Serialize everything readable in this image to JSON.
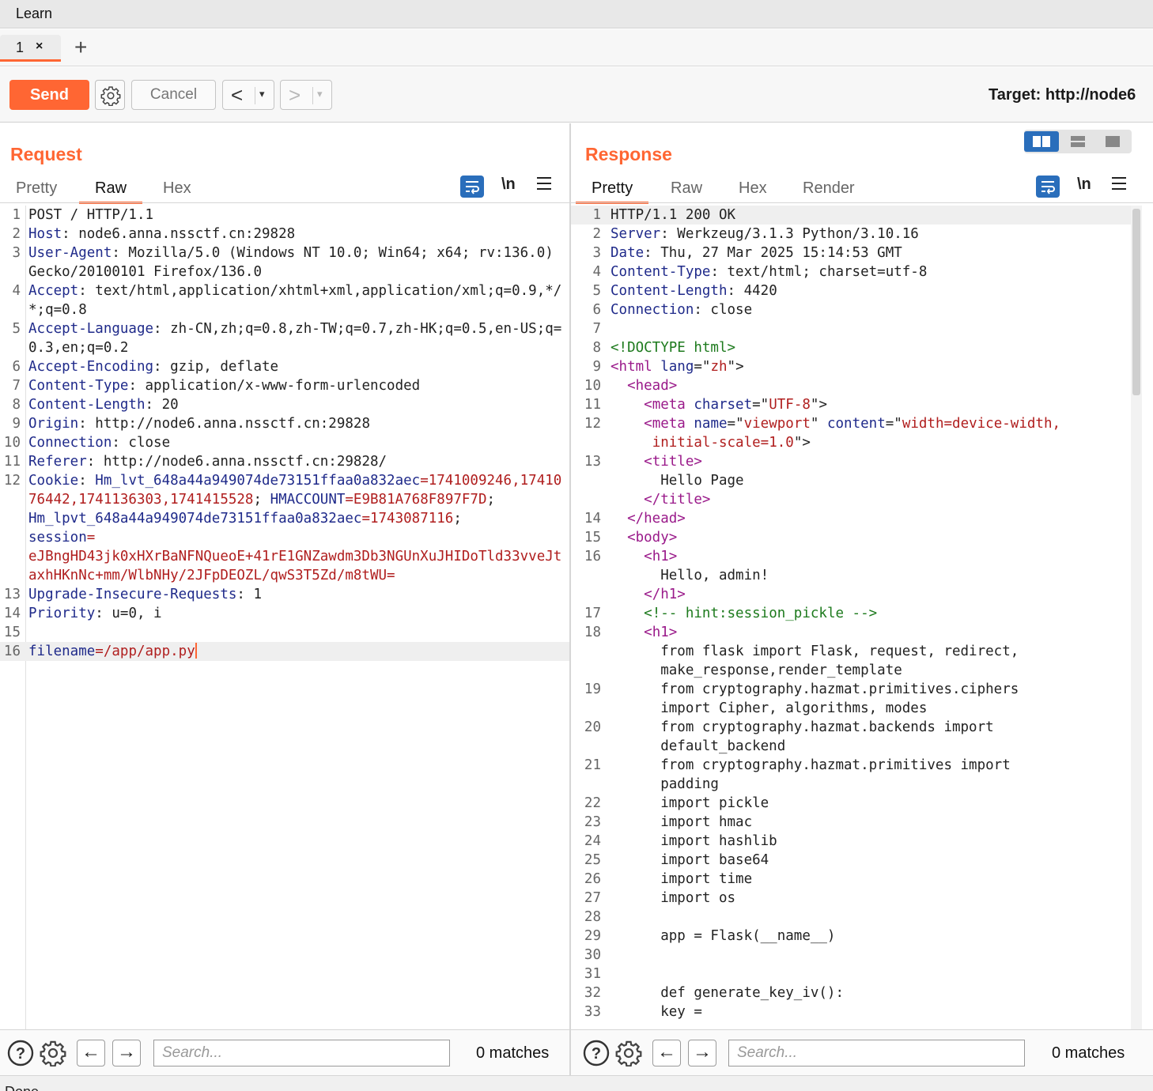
{
  "menu": {
    "learn": "Learn"
  },
  "tabs": {
    "tab1": "1",
    "close": "×",
    "add": "+"
  },
  "toolbar": {
    "send": "Send",
    "cancel": "Cancel",
    "back": "<",
    "forward": ">",
    "caret": "▾",
    "target": "Target: http://node6"
  },
  "request": {
    "title": "Request",
    "tabs": [
      "Pretty",
      "Raw",
      "Hex"
    ],
    "active_tab": "Raw",
    "newline_toggle": "\\n",
    "search_placeholder": "Search...",
    "matches": "0 matches",
    "lines": [
      {
        "n": "1",
        "segs": [
          {
            "t": "POST / HTTP/1.1",
            "c": "hval"
          }
        ]
      },
      {
        "n": "2",
        "segs": [
          {
            "t": "Host",
            "c": "hname"
          },
          {
            "t": ": node6.anna.nssctf.cn:29828",
            "c": "hval"
          }
        ]
      },
      {
        "n": "3",
        "segs": [
          {
            "t": "User-Agent",
            "c": "hname"
          },
          {
            "t": ": Mozilla/5.0 (Windows NT 10.0; Win64; x64; rv:136.0) Gecko/20100101 Firefox/136.0",
            "c": "hval"
          }
        ]
      },
      {
        "n": "4",
        "segs": [
          {
            "t": "Accept",
            "c": "hname"
          },
          {
            "t": ": text/html,application/xhtml+xml,application/xml;q=0.9,*/*;q=0.8",
            "c": "hval"
          }
        ]
      },
      {
        "n": "5",
        "segs": [
          {
            "t": "Accept-Language",
            "c": "hname"
          },
          {
            "t": ": zh-CN,zh;q=0.8,zh-TW;q=0.7,zh-HK;q=0.5,en-US;q=0.3,en;q=0.2",
            "c": "hval"
          }
        ]
      },
      {
        "n": "6",
        "segs": [
          {
            "t": "Accept-Encoding",
            "c": "hname"
          },
          {
            "t": ": gzip, deflate",
            "c": "hval"
          }
        ]
      },
      {
        "n": "7",
        "segs": [
          {
            "t": "Content-Type",
            "c": "hname"
          },
          {
            "t": ": application/x-www-form-urlencoded",
            "c": "hval"
          }
        ]
      },
      {
        "n": "8",
        "segs": [
          {
            "t": "Content-Length",
            "c": "hname"
          },
          {
            "t": ": 20",
            "c": "hval"
          }
        ]
      },
      {
        "n": "9",
        "segs": [
          {
            "t": "Origin",
            "c": "hname"
          },
          {
            "t": ": http://node6.anna.nssctf.cn:29828",
            "c": "hval"
          }
        ]
      },
      {
        "n": "10",
        "segs": [
          {
            "t": "Connection",
            "c": "hname"
          },
          {
            "t": ": close",
            "c": "hval"
          }
        ]
      },
      {
        "n": "11",
        "segs": [
          {
            "t": "Referer",
            "c": "hname"
          },
          {
            "t": ": http://node6.anna.nssctf.cn:29828/",
            "c": "hval"
          }
        ]
      },
      {
        "n": "12",
        "segs": [
          {
            "t": "Cookie",
            "c": "hname"
          },
          {
            "t": ": ",
            "c": "hval"
          },
          {
            "t": "Hm_lvt_648a44a949074de73151ffaa0a832aec",
            "c": "hname"
          },
          {
            "t": "=1741009246,1741076442,1741136303,1741415528",
            "c": "cval"
          },
          {
            "t": "; ",
            "c": "hval"
          },
          {
            "t": "HMACCOUNT",
            "c": "hname"
          },
          {
            "t": "=E9B81A768F897F7D",
            "c": "cval"
          },
          {
            "t": ";\n",
            "c": "hval"
          },
          {
            "t": "Hm_lpvt_648a44a949074de73151ffaa0a832aec",
            "c": "hname"
          },
          {
            "t": "=1743087116",
            "c": "cval"
          },
          {
            "t": ";\n",
            "c": "hval"
          },
          {
            "t": "session",
            "c": "hname"
          },
          {
            "t": "=\neJBngHD43jk0xHXrBaNFNQueoE+41rE1GNZawdm3Db3NGUnXuJHIDoTld33vveJtaxhHKnNc+mm/WlbNHy/2JFpDEOZL/qwS3T5Zd/m8tWU=",
            "c": "cval"
          }
        ]
      },
      {
        "n": "13",
        "segs": [
          {
            "t": "Upgrade-Insecure-Requests",
            "c": "hname"
          },
          {
            "t": ": 1",
            "c": "hval"
          }
        ]
      },
      {
        "n": "14",
        "segs": [
          {
            "t": "Priority",
            "c": "hname"
          },
          {
            "t": ": u=0, i",
            "c": "hval"
          }
        ]
      },
      {
        "n": "15",
        "segs": [
          {
            "t": "",
            "c": "hval"
          }
        ]
      },
      {
        "n": "16",
        "segs": [
          {
            "t": "filename",
            "c": "hname"
          },
          {
            "t": "=/app/app.py",
            "c": "cval"
          }
        ],
        "current": true
      }
    ]
  },
  "response": {
    "title": "Response",
    "tabs": [
      "Pretty",
      "Raw",
      "Hex",
      "Render"
    ],
    "active_tab": "Pretty",
    "newline_toggle": "\\n",
    "search_placeholder": "Search...",
    "matches": "0 matches",
    "lines": [
      {
        "n": "1",
        "segs": [
          {
            "t": "HTTP/1.1 200 OK",
            "c": "hval"
          }
        ],
        "current": true
      },
      {
        "n": "2",
        "segs": [
          {
            "t": "Server",
            "c": "hname"
          },
          {
            "t": ": Werkzeug/3.1.3 Python/3.10.16",
            "c": "hval"
          }
        ]
      },
      {
        "n": "3",
        "segs": [
          {
            "t": "Date",
            "c": "hname"
          },
          {
            "t": ": Thu, 27 Mar 2025 15:14:53 GMT",
            "c": "hval"
          }
        ]
      },
      {
        "n": "4",
        "segs": [
          {
            "t": "Content-Type",
            "c": "hname"
          },
          {
            "t": ": text/html; charset=utf-8",
            "c": "hval"
          }
        ]
      },
      {
        "n": "5",
        "segs": [
          {
            "t": "Content-Length",
            "c": "hname"
          },
          {
            "t": ": 4420",
            "c": "hval"
          }
        ]
      },
      {
        "n": "6",
        "segs": [
          {
            "t": "Connection",
            "c": "hname"
          },
          {
            "t": ": close",
            "c": "hval"
          }
        ]
      },
      {
        "n": "7",
        "segs": [
          {
            "t": "",
            "c": "hval"
          }
        ]
      },
      {
        "n": "8",
        "segs": [
          {
            "t": "<!DOCTYPE html>",
            "c": "doctype"
          }
        ]
      },
      {
        "n": "9",
        "segs": [
          {
            "t": "<html ",
            "c": "tag"
          },
          {
            "t": "lang",
            "c": "attr"
          },
          {
            "t": "=\"",
            "c": "txt"
          },
          {
            "t": "zh",
            "c": "str"
          },
          {
            "t": "\">",
            "c": "txt"
          }
        ]
      },
      {
        "n": "10",
        "segs": [
          {
            "t": "  <head>",
            "c": "tag"
          }
        ]
      },
      {
        "n": "11",
        "segs": [
          {
            "t": "    <meta ",
            "c": "tag"
          },
          {
            "t": "charset",
            "c": "attr"
          },
          {
            "t": "=\"",
            "c": "txt"
          },
          {
            "t": "UTF-8",
            "c": "str"
          },
          {
            "t": "\">",
            "c": "txt"
          }
        ]
      },
      {
        "n": "12",
        "segs": [
          {
            "t": "    <meta ",
            "c": "tag"
          },
          {
            "t": "name",
            "c": "attr"
          },
          {
            "t": "=\"",
            "c": "txt"
          },
          {
            "t": "viewport",
            "c": "str"
          },
          {
            "t": "\" ",
            "c": "txt"
          },
          {
            "t": "content",
            "c": "attr"
          },
          {
            "t": "=\"",
            "c": "txt"
          },
          {
            "t": "width=device-width,\n     initial-scale=1.0",
            "c": "str"
          },
          {
            "t": "\">",
            "c": "txt"
          }
        ]
      },
      {
        "n": "13",
        "segs": [
          {
            "t": "    <title>",
            "c": "tag"
          },
          {
            "t": "\n      Hello Page\n",
            "c": "txt"
          },
          {
            "t": "    </title>",
            "c": "tag"
          }
        ]
      },
      {
        "n": "14",
        "segs": [
          {
            "t": "  </head>",
            "c": "tag"
          }
        ]
      },
      {
        "n": "15",
        "segs": [
          {
            "t": "  <body>",
            "c": "tag"
          }
        ]
      },
      {
        "n": "16",
        "segs": [
          {
            "t": "    <h1>",
            "c": "tag"
          },
          {
            "t": "\n      Hello, admin!\n",
            "c": "txt"
          },
          {
            "t": "    </h1>",
            "c": "tag"
          }
        ]
      },
      {
        "n": "17",
        "segs": [
          {
            "t": "    <!-- hint:session_pickle -->",
            "c": "comment"
          }
        ]
      },
      {
        "n": "18",
        "segs": [
          {
            "t": "    <h1>",
            "c": "tag"
          },
          {
            "t": "\n      from flask import Flask, request, redirect,\n      make_response,render_template",
            "c": "txt"
          }
        ]
      },
      {
        "n": "19",
        "segs": [
          {
            "t": "      from cryptography.hazmat.primitives.ciphers\n      import Cipher, algorithms, modes",
            "c": "txt"
          }
        ]
      },
      {
        "n": "20",
        "segs": [
          {
            "t": "      from cryptography.hazmat.backends import\n      default_backend",
            "c": "txt"
          }
        ]
      },
      {
        "n": "21",
        "segs": [
          {
            "t": "      from cryptography.hazmat.primitives import\n      padding",
            "c": "txt"
          }
        ]
      },
      {
        "n": "22",
        "segs": [
          {
            "t": "      import pickle",
            "c": "txt"
          }
        ]
      },
      {
        "n": "23",
        "segs": [
          {
            "t": "      import hmac",
            "c": "txt"
          }
        ]
      },
      {
        "n": "24",
        "segs": [
          {
            "t": "      import hashlib",
            "c": "txt"
          }
        ]
      },
      {
        "n": "25",
        "segs": [
          {
            "t": "      import base64",
            "c": "txt"
          }
        ]
      },
      {
        "n": "26",
        "segs": [
          {
            "t": "      import time",
            "c": "txt"
          }
        ]
      },
      {
        "n": "27",
        "segs": [
          {
            "t": "      import os",
            "c": "txt"
          }
        ]
      },
      {
        "n": "28",
        "segs": [
          {
            "t": "",
            "c": "txt"
          }
        ]
      },
      {
        "n": "29",
        "segs": [
          {
            "t": "      app = Flask(__name__)",
            "c": "txt"
          }
        ]
      },
      {
        "n": "30",
        "segs": [
          {
            "t": "",
            "c": "txt"
          }
        ]
      },
      {
        "n": "31",
        "segs": [
          {
            "t": "",
            "c": "txt"
          }
        ]
      },
      {
        "n": "32",
        "segs": [
          {
            "t": "      def generate_key_iv():",
            "c": "txt"
          }
        ]
      },
      {
        "n": "33",
        "segs": [
          {
            "t": "      key =",
            "c": "txt"
          }
        ]
      }
    ]
  },
  "status": {
    "text": "Done"
  }
}
